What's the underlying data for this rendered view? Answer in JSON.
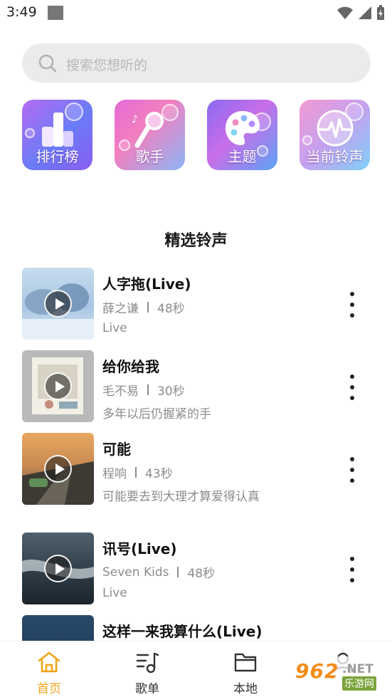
{
  "status_bar": {
    "time": "3:49"
  },
  "search": {
    "placeholder": "搜索您想听的"
  },
  "categories": [
    {
      "label": "排行榜",
      "icon": "ranking-icon"
    },
    {
      "label": "歌手",
      "icon": "microphone-icon"
    },
    {
      "label": "主题",
      "icon": "palette-icon"
    },
    {
      "label": "当前铃声",
      "icon": "waveform-icon"
    }
  ],
  "section": {
    "title": "精选铃声"
  },
  "songs": [
    {
      "title": "人字拖(Live)",
      "artist": "薛之谦",
      "duration": "48秒",
      "desc": "Live"
    },
    {
      "title": "给你给我",
      "artist": "毛不易",
      "duration": "30秒",
      "desc": "多年以后仍握紧的手"
    },
    {
      "title": "可能",
      "artist": "程响",
      "duration": "43秒",
      "desc": "可能要去到大理才算爱得认真"
    },
    {
      "title": "讯号(Live)",
      "artist": "Seven Kids",
      "duration": "48秒",
      "desc": "Live"
    },
    {
      "title": "这样一来我算什么(Live)",
      "artist": "",
      "duration": "",
      "desc": ""
    }
  ],
  "nav": [
    {
      "label": "首页",
      "icon": "home-icon",
      "active": true
    },
    {
      "label": "歌单",
      "icon": "playlist-icon",
      "active": false
    },
    {
      "label": "本地",
      "icon": "folder-icon",
      "active": false
    },
    {
      "label": "",
      "icon": "profile-icon",
      "active": false
    }
  ],
  "watermark": {
    "number": "962",
    "suffix": ".NET",
    "text": "乐游网"
  },
  "colors": {
    "accent": "#f0a418",
    "secondary_text": "#8c8c8c",
    "search_bg": "#ebebeb"
  }
}
